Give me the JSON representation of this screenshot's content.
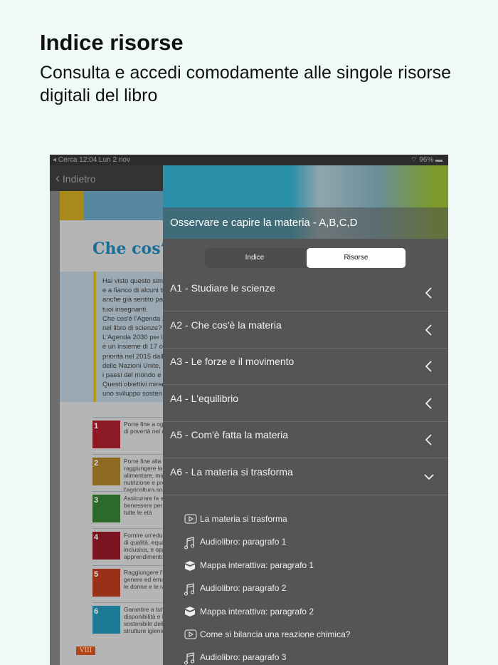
{
  "header": {
    "title": "Indice risorse",
    "subtitle": "Consulta e accedi comodamente alle singole risorse digitali del libro"
  },
  "status": {
    "left": "◂ Cerca   12:04   Lun 2 nov",
    "right": "96%"
  },
  "nav": {
    "back": "Indietro"
  },
  "book": {
    "title": "Che cos’è",
    "page": "VIII",
    "box_lines": [
      "Hai visto questo simb",
      "e a fianco di alcuni tit",
      "anche già sentito par",
      "tuoi insegnanti.",
      "Che cos'è l'Agenda 2",
      "nel libro di scienze?",
      "L'Agenda 2030 per l",
      "è un insieme di 17 ob",
      "priorità nel 2015 dall",
      "delle Nazioni Unite, c",
      "i paesi del mondo e h",
      "Questi obiettivi mirar",
      "uno sviluppo sosten"
    ],
    "goals": [
      {
        "n": "1",
        "color": "#8c1a24",
        "text": "Porre fine a ogni\ndi povertà nel m"
      },
      {
        "n": "2",
        "color": "#8c6a22",
        "text": "Porre fine alla fa\nraggiungere la si\nalimentare, migli\nnutrizione e pron\nl'agricoltura sost"
      },
      {
        "n": "3",
        "color": "#2c6a2a",
        "text": "Assicurare la salu\nbenessere per tu\ntutte le età"
      },
      {
        "n": "4",
        "color": "#7a1420",
        "text": "Fornire un'educa\ndi qualità, equa e\ninclusiva, e oppo\napprendimento p"
      },
      {
        "n": "5",
        "color": "#9a3018",
        "text": "Raggiungere l'ug\ngenere ed emanc\nle donne e le rag"
      },
      {
        "n": "6",
        "color": "#1c7a96",
        "text": "Garantire a tutti\ndisponibilità e la\nsostenibile dell'a\nstrutture igienico"
      }
    ]
  },
  "panel": {
    "title": "Osservare e capire la materia - A,B,C,D",
    "tabs": {
      "index": "Indice",
      "resources": "Risorse"
    },
    "chapters": [
      "A1 - Studiare le scienze",
      "A2 - Che cos'è la materia",
      "A3 - Le forze e il movimento",
      "A4 - L'equilibrio",
      "A5 - Com'è fatta la materia",
      "A6 - La materia si trasforma"
    ],
    "resources": [
      {
        "icon": "video-icon",
        "label": "La materia si trasforma"
      },
      {
        "icon": "music-note-icon",
        "label": "Audiolibro: paragrafo 1"
      },
      {
        "icon": "map-box-icon",
        "label": "Mappa interattiva: paragrafo 1"
      },
      {
        "icon": "music-note-icon",
        "label": "Audiolibro: paragrafo 2"
      },
      {
        "icon": "map-box-icon",
        "label": "Mappa interattiva: paragrafo 2"
      },
      {
        "icon": "video-icon",
        "label": "Come si bilancia una reazione chimica?"
      },
      {
        "icon": "music-note-icon",
        "label": "Audiolibro: paragrafo 3"
      }
    ]
  }
}
